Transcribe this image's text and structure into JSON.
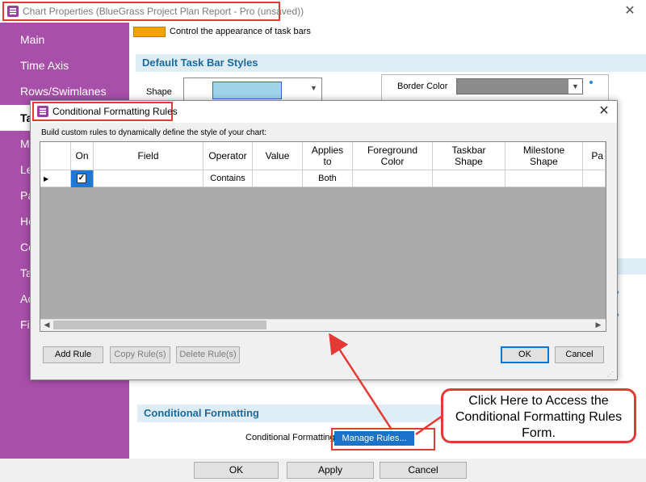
{
  "outer_window": {
    "title": "Chart Properties (BlueGrass Project Plan Report - Pro (unsaved))",
    "close_glyph": "✕"
  },
  "sidebar": {
    "items": [
      {
        "label": "Main",
        "active": false
      },
      {
        "label": "Time Axis",
        "active": false
      },
      {
        "label": "Rows/Swimlanes",
        "active": false
      },
      {
        "label": "Ta",
        "active": true
      },
      {
        "label": "M",
        "active": false
      },
      {
        "label": "Le",
        "active": false
      },
      {
        "label": "Pa",
        "active": false
      },
      {
        "label": "He",
        "active": false
      },
      {
        "label": "Co",
        "active": false
      },
      {
        "label": "Ta",
        "active": false
      },
      {
        "label": "Ac",
        "active": false
      },
      {
        "label": "Fi",
        "active": false
      }
    ]
  },
  "content": {
    "taskbar_desc": "Control the appearance of task bars",
    "default_styles_heading": "Default Task Bar Styles",
    "shape_label": "Shape",
    "border_color_label": "Border Color",
    "conditional_heading": "Conditional Formatting",
    "conditional_label": "Conditional Formatting",
    "manage_rules_label": "Manage Rules...",
    "colors": {
      "taskbar_swatch": "#f5a300",
      "shape_swatch": "#9ed3ea",
      "border_color": "#8c8c8c"
    }
  },
  "bottom_buttons": {
    "ok": "OK",
    "apply": "Apply",
    "cancel": "Cancel"
  },
  "dialog": {
    "title": "Conditional Formatting Rules",
    "close_glyph": "✕",
    "description": "Build custom rules to dynamically define the style of your chart:",
    "columns": [
      "On",
      "Field",
      "Operator",
      "Value",
      "Applies to",
      "Foreground Color",
      "Taskbar Shape",
      "Milestone Shape",
      "Pa"
    ],
    "rows": [
      {
        "on": true,
        "field": "",
        "operator": "Contains",
        "value": "",
        "applies_to": "Both",
        "foreground_color": "",
        "taskbar_shape": "",
        "milestone_shape": ""
      }
    ],
    "buttons": {
      "add_rule": "Add Rule",
      "copy_rule": "Copy Rule(s)",
      "delete_rule": "Delete Rule(s)",
      "ok": "OK",
      "cancel": "Cancel"
    }
  },
  "callout": {
    "text": "Click Here to Access the Conditional Formatting Rules Form."
  },
  "accent_colors": {
    "purple": "#a74fa9",
    "highlight_red": "#e53935",
    "link_blue": "#1b6aa0",
    "selection_blue": "#1e78d6"
  }
}
